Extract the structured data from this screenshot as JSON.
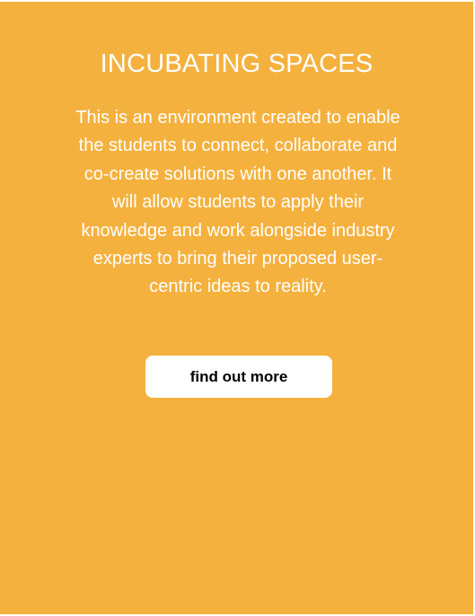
{
  "colors": {
    "card_background": "#F5B13E",
    "text": "#FFFFFF",
    "button_background": "#FFFFFF",
    "button_text": "#000000"
  },
  "card": {
    "title": "INCUBATING SPACES",
    "description": "This is an environment created to enable the students to connect, collaborate and co-create solutions with one another. It will allow students to apply their knowledge and work alongside industry experts to bring their proposed user-centric ideas to reality.",
    "button_label": "find out more"
  }
}
